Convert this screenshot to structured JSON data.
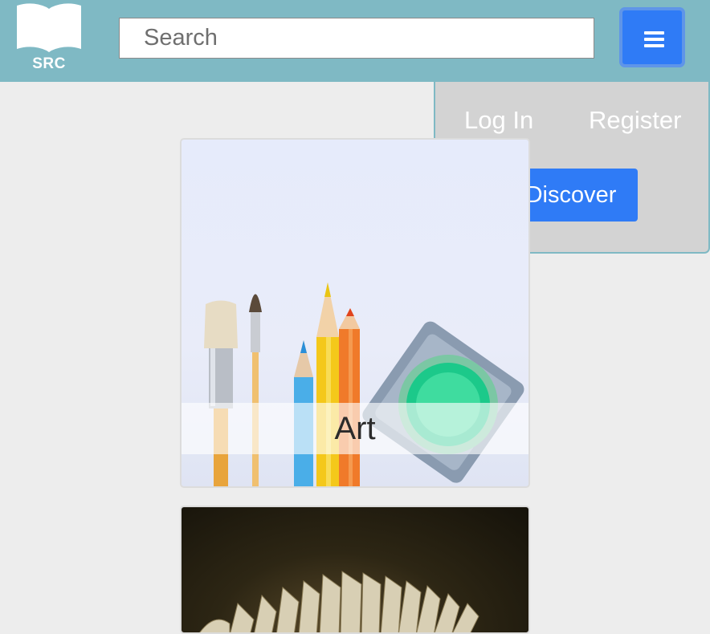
{
  "brand": {
    "logo_text": "SRC"
  },
  "search": {
    "placeholder": "Search",
    "value": ""
  },
  "menu": {
    "icon": "hamburger-icon",
    "login_label": "Log In",
    "register_label": "Register",
    "discover_label": "Discover"
  },
  "categories": [
    {
      "label": "Art",
      "image": "paintbrushes-pencils-paint-palette"
    },
    {
      "label": "",
      "image": "fanned-book-pages"
    }
  ],
  "colors": {
    "navbar": "#7fb9c4",
    "primary_button": "#2f7bf6",
    "dropdown_bg": "#d3d3d3",
    "page_bg": "#ededed"
  }
}
